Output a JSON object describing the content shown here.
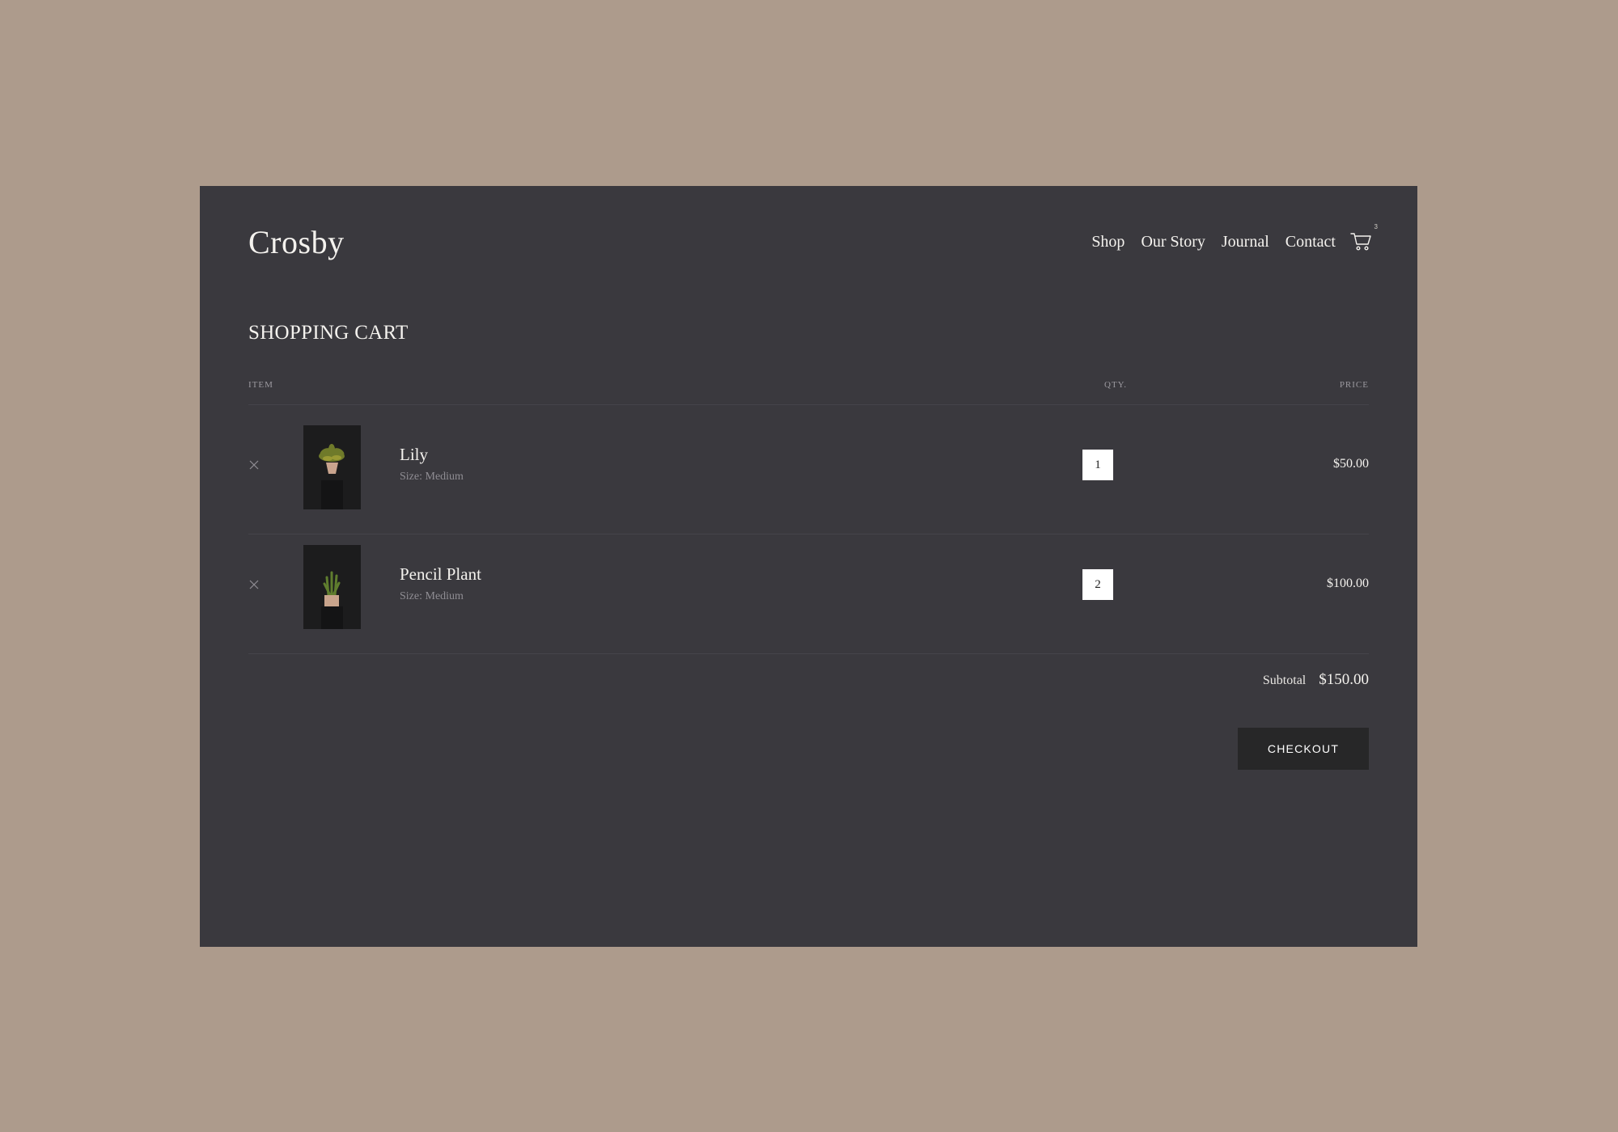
{
  "brand": {
    "logo": "Crosby"
  },
  "nav": {
    "items": [
      {
        "label": "Shop"
      },
      {
        "label": "Our Story"
      },
      {
        "label": "Journal"
      },
      {
        "label": "Contact"
      }
    ],
    "cart_count": "3"
  },
  "page": {
    "title": "SHOPPING CART"
  },
  "table": {
    "headers": {
      "item": "ITEM",
      "qty": "QTY.",
      "price": "PRICE"
    },
    "rows": [
      {
        "name": "Lily",
        "size": "Size: Medium",
        "qty": "1",
        "price": "$50.00"
      },
      {
        "name": "Pencil Plant",
        "size": "Size: Medium",
        "qty": "2",
        "price": "$100.00"
      }
    ]
  },
  "summary": {
    "subtotal_label": "Subtotal",
    "subtotal_value": "$150.00"
  },
  "actions": {
    "checkout_label": "CHECKOUT"
  },
  "colors": {
    "backdrop": "#ad9b8c",
    "panel": "#3a393e",
    "button": "#272728",
    "text": "#f4f2ee"
  }
}
